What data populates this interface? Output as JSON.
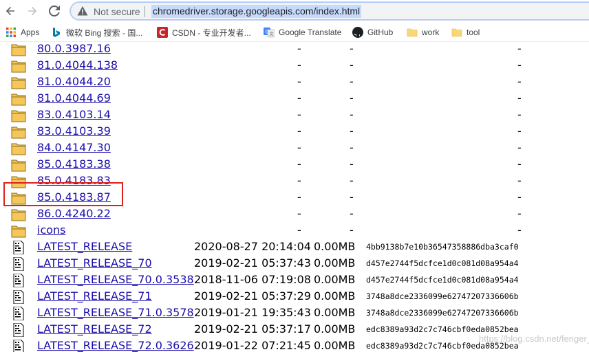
{
  "browser": {
    "security_label": "Not secure",
    "url": "chromedriver.storage.googleapis.com/index.html"
  },
  "bookmarks": [
    {
      "label": "Apps",
      "icon": "apps-grid-icon",
      "color": "#d93025"
    },
    {
      "label": "微软 Bing 搜索 - 国...",
      "icon": "bing-icon",
      "color": "#00809d"
    },
    {
      "label": "CSDN - 专业开发者...",
      "icon": "csdn-icon",
      "color": "#c9242b"
    },
    {
      "label": "Google Translate",
      "icon": "google-translate-icon",
      "color": "#4285f4"
    },
    {
      "label": "GitHub",
      "icon": "github-icon",
      "color": "#1b1f23"
    },
    {
      "label": "work",
      "icon": "folder-icon",
      "color": "#f8d775"
    },
    {
      "label": "tool",
      "icon": "folder-icon",
      "color": "#f8d775"
    }
  ],
  "listing": {
    "folders": [
      {
        "name": "80.0.3987.16"
      },
      {
        "name": "81.0.4044.138"
      },
      {
        "name": "81.0.4044.20"
      },
      {
        "name": "81.0.4044.69"
      },
      {
        "name": "83.0.4103.14"
      },
      {
        "name": "83.0.4103.39"
      },
      {
        "name": "84.0.4147.30"
      },
      {
        "name": "85.0.4183.38"
      },
      {
        "name": "85.0.4183.83"
      },
      {
        "name": "85.0.4183.87"
      },
      {
        "name": "86.0.4240.22"
      },
      {
        "name": "icons"
      }
    ],
    "dash": "-",
    "files": [
      {
        "name": "LATEST_RELEASE",
        "date": "2020-08-27 20:14:04",
        "size": "0.00MB",
        "hash": "4bb9138b7e10b36547358886dba3caf0"
      },
      {
        "name": "LATEST_RELEASE_70",
        "date": "2019-02-21 05:37:43",
        "size": "0.00MB",
        "hash": "d457e2744f5dcfce1d0c081d08a954a4"
      },
      {
        "name": "LATEST_RELEASE_70.0.3538",
        "date": "2018-11-06 07:19:08",
        "size": "0.00MB",
        "hash": "d457e2744f5dcfce1d0c081d08a954a4"
      },
      {
        "name": "LATEST_RELEASE_71",
        "date": "2019-02-21 05:37:29",
        "size": "0.00MB",
        "hash": "3748a8dce2336099e62747207336606b"
      },
      {
        "name": "LATEST_RELEASE_71.0.3578",
        "date": "2019-01-21 19:35:43",
        "size": "0.00MB",
        "hash": "3748a8dce2336099e62747207336606b"
      },
      {
        "name": "LATEST_RELEASE_72",
        "date": "2019-02-21 05:37:17",
        "size": "0.00MB",
        "hash": "edc8389a93d2c7c746cbf0eda0852bea"
      },
      {
        "name": "LATEST_RELEASE_72.0.3626",
        "date": "2019-01-22 07:21:45",
        "size": "0.00MB",
        "hash": "edc8389a93d2c7c746cbf0eda0852bea"
      }
    ],
    "highlighted": "85.0.4183.87"
  },
  "watermark": "https://blog.csdn.net/fenger_c",
  "colors": {
    "link": "#1a0dab",
    "highlight_border": "#e0201b",
    "folder": "#f5c65a"
  }
}
